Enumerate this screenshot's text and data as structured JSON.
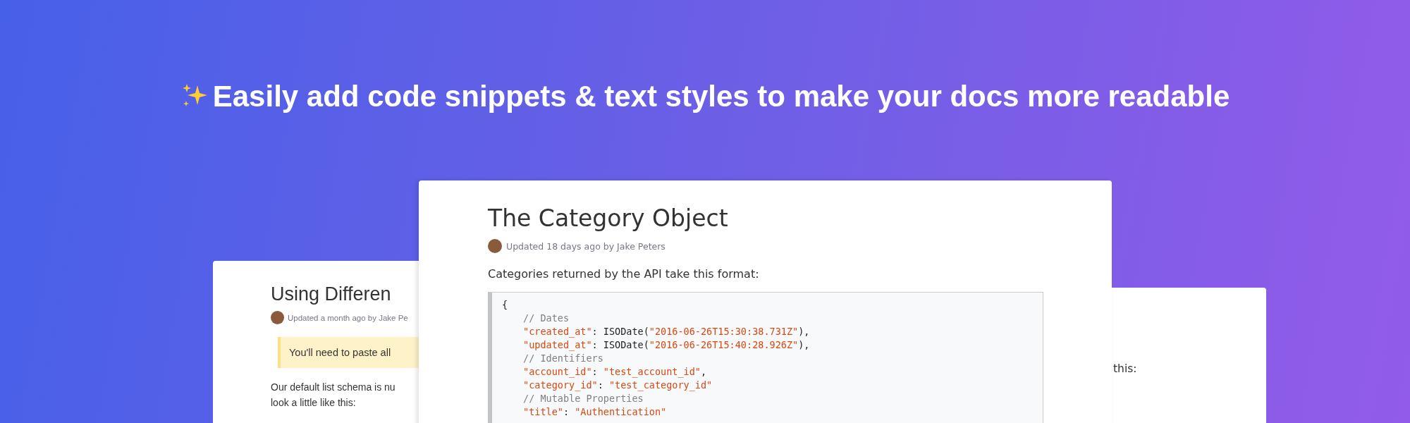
{
  "headline": "Easily add code snippets & text styles to make your docs more readable",
  "cards": [
    {
      "kind": "back_left",
      "title": "Using Differen",
      "meta": "Updated a month ago by Jake Pe",
      "notice": "You'll need to paste all",
      "paragraph_lines": [
        "Our default list schema is nu",
        "look a little like this:"
      ]
    },
    {
      "kind": "front",
      "title": "The Category Object",
      "meta": "Updated 18 days ago by Jake Peters",
      "paragraph_lines": [
        "Categories returned by the API take this format:"
      ],
      "code_lines": [
        {
          "indented": false,
          "tokens": [
            {
              "kind": "plain",
              "text": "{"
            }
          ]
        },
        {
          "indented": true,
          "tokens": [
            {
              "kind": "comment",
              "text": "// Dates"
            }
          ]
        },
        {
          "indented": true,
          "tokens": [
            {
              "kind": "string",
              "text": "\"created_at\""
            },
            {
              "kind": "plain",
              "text": ": ISODate("
            },
            {
              "kind": "string",
              "text": "\"2016-06-26T15:30:38.731Z\""
            },
            {
              "kind": "plain",
              "text": "),"
            }
          ]
        },
        {
          "indented": true,
          "tokens": [
            {
              "kind": "string",
              "text": "\"updated_at\""
            },
            {
              "kind": "plain",
              "text": ": ISODate("
            },
            {
              "kind": "string",
              "text": "\"2016-06-26T15:40:28.926Z\""
            },
            {
              "kind": "plain",
              "text": "),"
            }
          ]
        },
        {
          "indented": true,
          "tokens": [
            {
              "kind": "comment",
              "text": "// Identifiers"
            }
          ]
        },
        {
          "indented": true,
          "tokens": [
            {
              "kind": "string",
              "text": "\"account_id\""
            },
            {
              "kind": "plain",
              "text": ": "
            },
            {
              "kind": "string",
              "text": "\"test_account_id\""
            },
            {
              "kind": "plain",
              "text": ","
            }
          ]
        },
        {
          "indented": true,
          "tokens": [
            {
              "kind": "string",
              "text": "\"category_id\""
            },
            {
              "kind": "plain",
              "text": ": "
            },
            {
              "kind": "string",
              "text": "\"test_category_id\""
            }
          ]
        },
        {
          "indented": true,
          "tokens": [
            {
              "kind": "comment",
              "text": "// Mutable Properties"
            }
          ]
        },
        {
          "indented": true,
          "tokens": [
            {
              "kind": "string",
              "text": "\"title\""
            },
            {
              "kind": "plain",
              "text": ": "
            },
            {
              "kind": "string",
              "text": "\"Authentication\""
            }
          ]
        }
      ]
    },
    {
      "kind": "back_right",
      "paragraph_lines": [
        "this:"
      ]
    }
  ]
}
